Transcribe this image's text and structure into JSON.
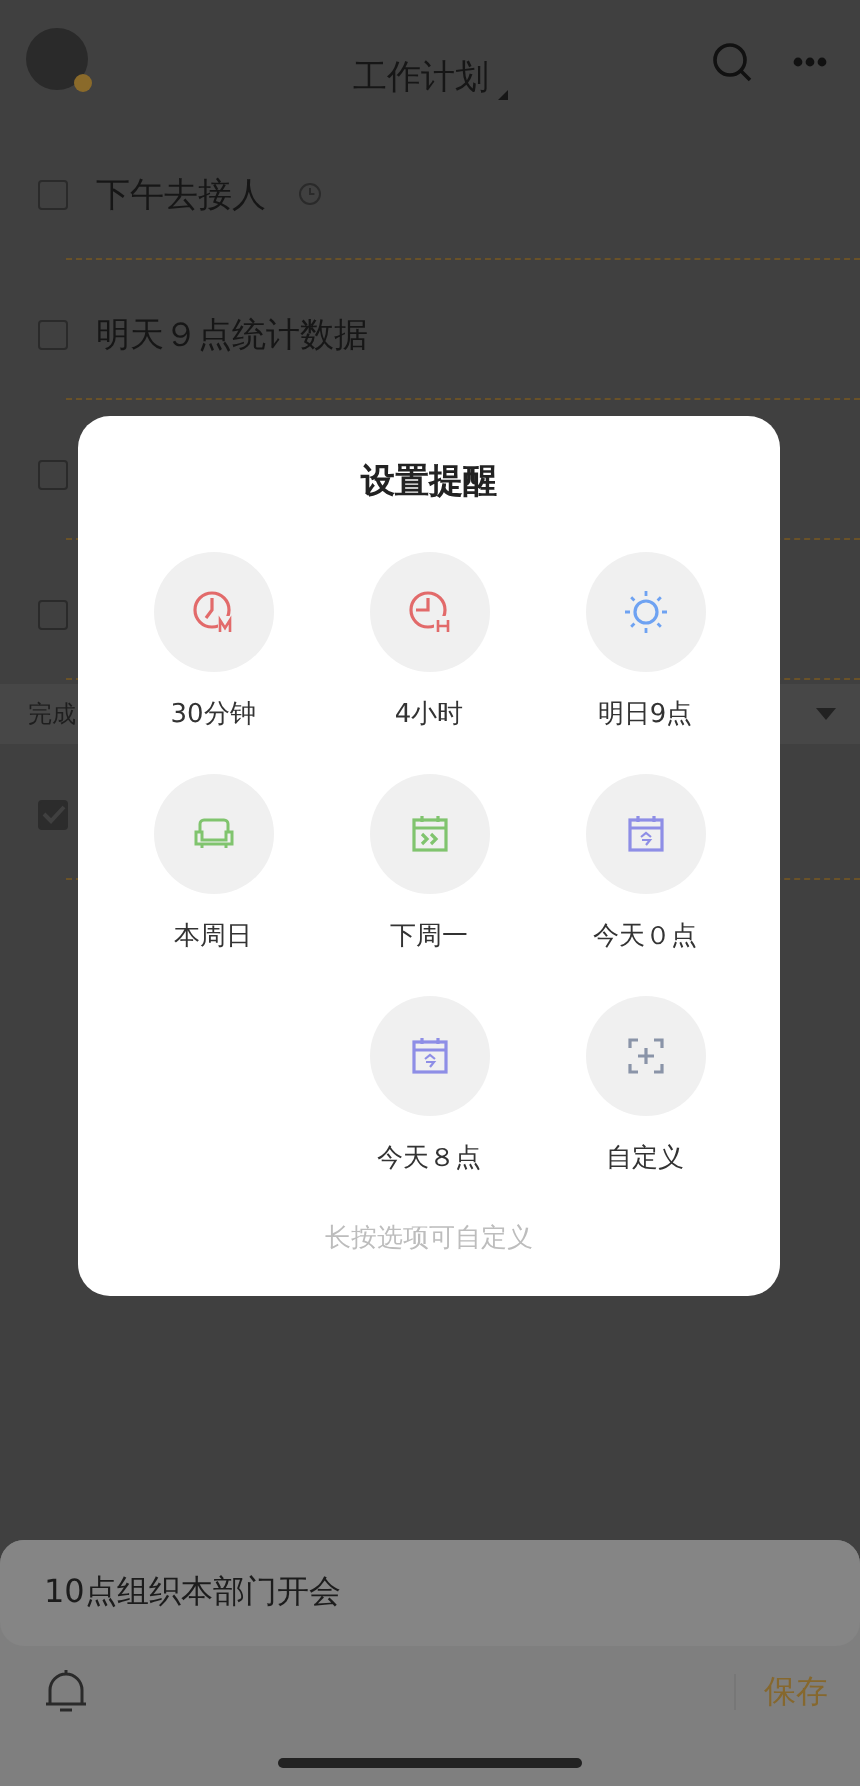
{
  "header": {
    "title": "工作计划"
  },
  "tasks": [
    {
      "text": "下午去接人",
      "checked": false,
      "has_reminder": true
    },
    {
      "text": "明天９点统计数据",
      "checked": false,
      "has_reminder": false
    },
    {
      "checked": false
    },
    {
      "checked": false
    }
  ],
  "completed_section": {
    "label": "完成",
    "expanded": true,
    "tasks": [
      {
        "checked": true
      }
    ]
  },
  "reminder_dialog": {
    "title": "设置提醒",
    "option_rows": [
      [
        {
          "label": "30分钟",
          "kind": "clock-m",
          "color": "#e26a6a"
        },
        {
          "label": "4小时",
          "kind": "clock-h",
          "color": "#e26a6a"
        },
        {
          "label": "明日9点",
          "kind": "sun",
          "color": "#6ea2f2"
        }
      ],
      [
        {
          "label": "本周日",
          "kind": "sofa",
          "color": "#80c46e"
        },
        {
          "label": "下周一",
          "kind": "calendar-next",
          "color": "#80c46e"
        },
        {
          "label": "今天０点",
          "kind": "calendar-today",
          "color": "#8e8ee6"
        }
      ],
      [
        {
          "label": "今天８点",
          "kind": "calendar-today",
          "color": "#8e8ee6"
        },
        {
          "label": "自定义",
          "kind": "custom",
          "color": "#8a94a8"
        }
      ]
    ],
    "hint": "长按选项可自定义"
  },
  "composer": {
    "value": "10点组织本部门开会",
    "save_label": "保存"
  }
}
